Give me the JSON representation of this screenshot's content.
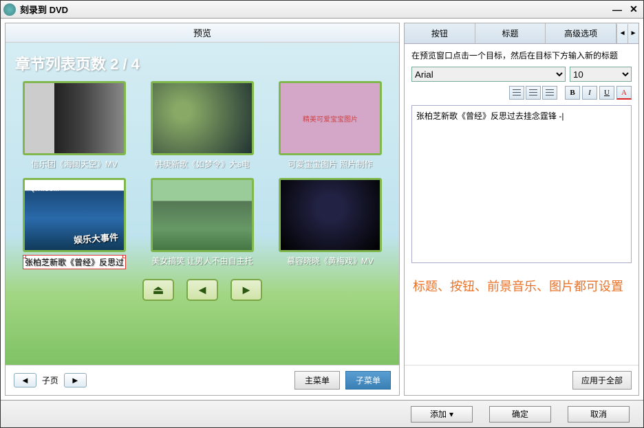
{
  "window": {
    "title": "刻录到 DVD"
  },
  "preview": {
    "header": "预览",
    "pageTitle": "章节列表页数 2 / 4",
    "thumbs": [
      {
        "caption": "信乐团《海阔天空》MV",
        "overlay": "",
        "cls": "t1"
      },
      {
        "caption": "韩庚新歌《如梦令》大s电",
        "overlay": "",
        "cls": "t2"
      },
      {
        "caption": "可爱宝宝图片 照片制作",
        "overlay": "精美可爱宝宝图片",
        "cls": "t3"
      },
      {
        "caption": "张柏芝新歌《曾经》反思过",
        "overlay": "",
        "cls": "t4",
        "editing": true
      },
      {
        "caption": "美女搞笑 让男人不由自主托",
        "overlay": "",
        "cls": "t5"
      },
      {
        "caption": "慕容晓晓《黄梅戏》MV",
        "overlay": "",
        "cls": "t6"
      }
    ],
    "thumb4": {
      "logo": "QIYI.COM",
      "text": "娱乐大事件"
    },
    "footer": {
      "subpage": "子页",
      "mainMenu": "主菜单",
      "subMenu": "子菜单"
    }
  },
  "right": {
    "tabs": {
      "button": "按钮",
      "title": "标题",
      "advanced": "高级选项"
    },
    "instruction": "在预览窗口点击一个目标，然后在目标下方输入新的标题",
    "font": "Arial",
    "size": "10",
    "format": {
      "bold": "B",
      "italic": "I",
      "underline": "U",
      "color": "A"
    },
    "editText": "张柏芝新歌《曾经》反思过去挂念霆锋 -|",
    "hint": "标题、按钮、前景音乐、图片都可设置",
    "applyAll": "应用于全部"
  },
  "bottom": {
    "add": "添加",
    "ok": "确定",
    "cancel": "取消"
  }
}
